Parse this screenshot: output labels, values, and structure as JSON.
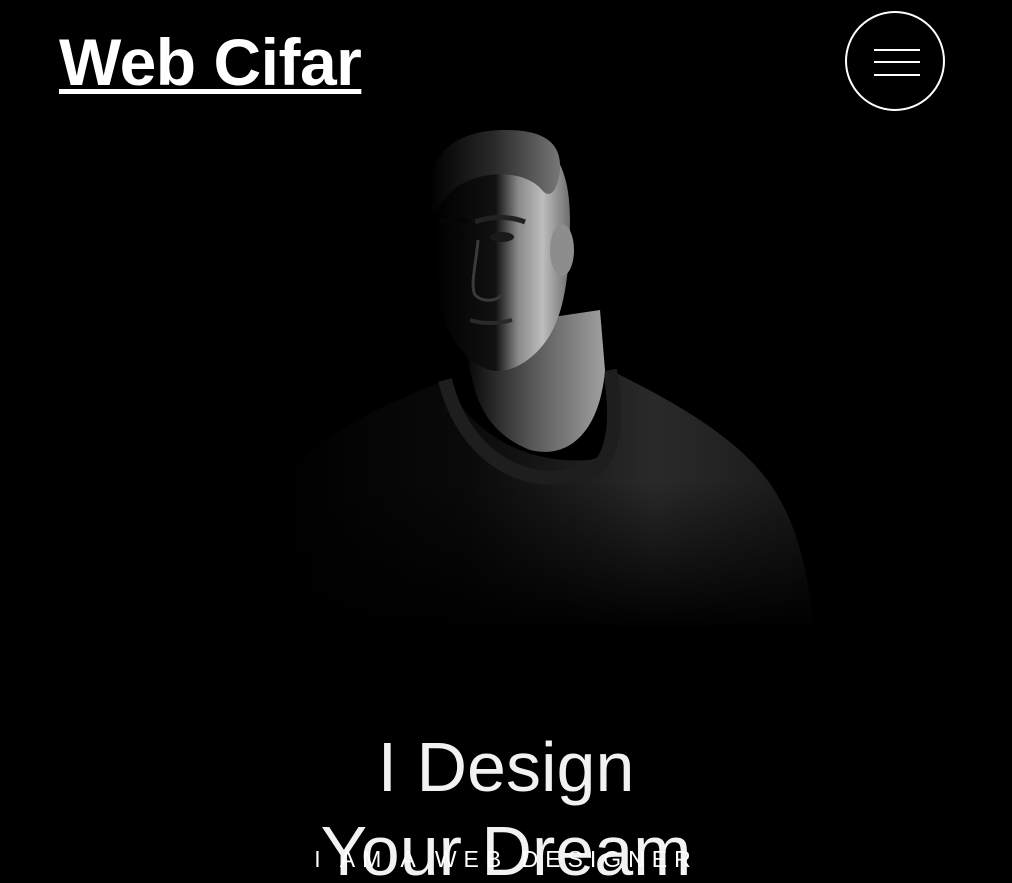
{
  "header": {
    "logo_text": "Web Cifar",
    "menu_icon": "hamburger-menu-icon"
  },
  "hero": {
    "image_subject": "black-and-white portrait of man in dark t-shirt",
    "headline_line1": "I Design",
    "headline_line2": "Your Dream",
    "subtitle": "I AM A WEB DESIGNER"
  },
  "colors": {
    "background": "#000000",
    "text": "#ffffff"
  }
}
